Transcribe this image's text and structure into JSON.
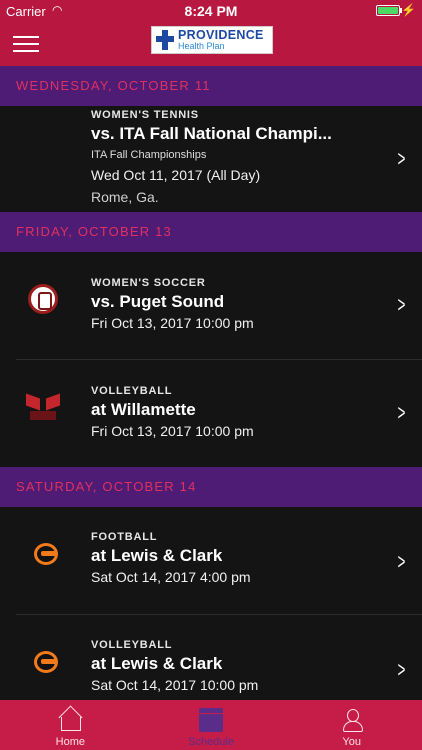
{
  "status_bar": {
    "carrier": "Carrier",
    "time": "8:24 PM"
  },
  "header": {
    "sponsor_name": "PROVIDENCE",
    "sponsor_sub": "Health Plan"
  },
  "sections": [
    {
      "date": "WEDNESDAY, OCTOBER 11",
      "events": [
        {
          "sport": "WOMEN'S TENNIS",
          "opponent": "vs. ITA Fall National Champi...",
          "subtitle": "ITA Fall Championships",
          "datetime": "Wed Oct 11, 2017 (All Day)",
          "location": "Rome, Ga."
        }
      ]
    },
    {
      "date": "FRIDAY, OCTOBER 13",
      "events": [
        {
          "sport": "WOMEN'S SOCCER",
          "opponent": "vs. Puget Sound",
          "datetime": "Fri Oct 13, 2017 10:00 pm"
        },
        {
          "sport": "VOLLEYBALL",
          "opponent": "at Willamette",
          "datetime": "Fri Oct 13, 2017 10:00 pm"
        }
      ]
    },
    {
      "date": "SATURDAY, OCTOBER 14",
      "events": [
        {
          "sport": "FOOTBALL",
          "opponent": "at Lewis & Clark",
          "datetime": "Sat Oct 14, 2017 4:00 pm"
        },
        {
          "sport": "VOLLEYBALL",
          "opponent": "at Lewis & Clark",
          "datetime": "Sat Oct 14, 2017 10:00 pm"
        }
      ]
    }
  ],
  "tabbar": {
    "home": "Home",
    "schedule": "Schedule",
    "you": "You",
    "active": "Schedule"
  },
  "colors": {
    "header": "#b8173f",
    "section": "#4e1c75",
    "section_text": "#e0305f",
    "tabbar": "#c51d47"
  }
}
